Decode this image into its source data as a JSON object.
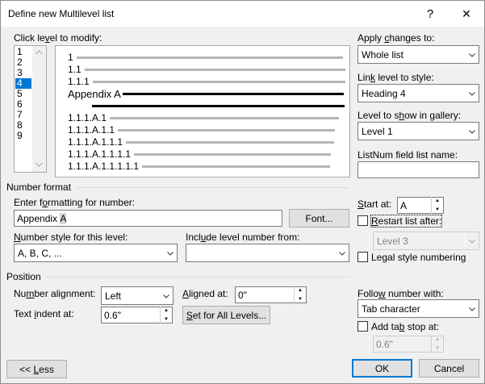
{
  "dialog": {
    "title": "Define new Multilevel list",
    "help": "?",
    "close": "✕"
  },
  "level": {
    "label": "Click level to modify:",
    "items": [
      "1",
      "2",
      "3",
      "4",
      "5",
      "6",
      "7",
      "8",
      "9"
    ],
    "selected": "4"
  },
  "preview": {
    "lines": [
      "1",
      "1.1",
      "1.1.1",
      "Appendix A",
      "",
      "1.1.1.A.1",
      "1.1.1.A.1.1",
      "1.1.1.A.1.1.1",
      "1.1.1.A.1.1.1.1",
      "1.1.1.A.1.1.1.1.1"
    ]
  },
  "apply_changes": {
    "label": "Apply changes to:",
    "value": "Whole list"
  },
  "link_level": {
    "label": "Link level to style:",
    "value": "Heading 4"
  },
  "gallery_level": {
    "label": "Level to show in gallery:",
    "value": "Level 1"
  },
  "listnum": {
    "label": "ListNum field list name:",
    "value": ""
  },
  "number_format": {
    "section": "Number format",
    "enter_label": "Enter formatting for number:",
    "format_prefix": "Appendix ",
    "format_field": "A",
    "font_button": "Font...",
    "style_label": "Number style for this level:",
    "style_value": "A, B, C, ...",
    "include_label": "Include level number from:",
    "include_value": "",
    "start_label": "Start at:",
    "start_value": "A",
    "restart_label": "Restart list after:",
    "restart_value": "Level 3",
    "legal_label": "Legal style numbering"
  },
  "position": {
    "section": "Position",
    "alignment_label": "Number alignment:",
    "alignment_value": "Left",
    "aligned_at_label": "Aligned at:",
    "aligned_at_value": "0\"",
    "indent_label": "Text indent at:",
    "indent_value": "0.6\"",
    "set_all_button": "Set for All Levels...",
    "follow_label": "Follow number with:",
    "follow_value": "Tab character",
    "tab_stop_label": "Add tab stop at:",
    "tab_stop_value": "0.6\""
  },
  "footer": {
    "less_button": "<< Less",
    "ok_button": "OK",
    "cancel_button": "Cancel"
  },
  "colors": {
    "accent": "#0078d7",
    "background": "#f0f0f0"
  }
}
